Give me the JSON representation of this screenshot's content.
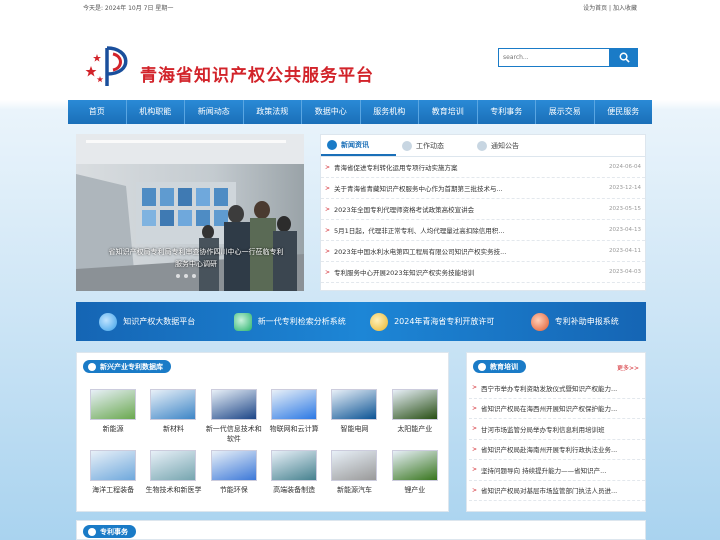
{
  "topbar": {
    "date": "今天是:  2024年 10月 7日 星期一",
    "set_home": "设为首页",
    "sep": "|",
    "favorite": "加入收藏"
  },
  "header": {
    "title": "青海省知识产权公共服务平台"
  },
  "search": {
    "placeholder": "search..."
  },
  "nav": [
    "首页",
    "机构职能",
    "新闻动态",
    "政策法规",
    "数据中心",
    "服务机构",
    "教育培训",
    "专利事务",
    "展示交易",
    "便民服务"
  ],
  "slider": {
    "caption": "省知识产权局专利局专利审查协作四川中心一行莅临专利服务中心调研"
  },
  "news": {
    "tabs": [
      "新闻资讯",
      "工作动态",
      "通知公告"
    ],
    "items": [
      {
        "title": "青海省促进专利转化运用专项行动实施方案",
        "date": "2024-06-04"
      },
      {
        "title": "关于青海省青藏知识产权服务中心作为首期第三批技术与...",
        "date": "2023-12-14"
      },
      {
        "title": "2023年全国专利代理师资格考试政策高校宣讲会",
        "date": "2023-05-15"
      },
      {
        "title": "5月1日起，代理非正常专利、人均代理量过高扣除信用积...",
        "date": "2023-04-13"
      },
      {
        "title": "2023年中国水利水电第四工程局有限公司知识产权实务技...",
        "date": "2023-04-11"
      },
      {
        "title": "专利服务中心开展2023年知识产权实务技能培训",
        "date": "2023-04-03"
      }
    ]
  },
  "banner": [
    {
      "label": "知识产权大数据平台",
      "icon": "globe-icon",
      "color": "#3aa0e8"
    },
    {
      "label": "新一代专利检索分析系统",
      "icon": "search-system-icon",
      "color": "#27b26b"
    },
    {
      "label": "2024年青海省专利开放许可",
      "icon": "license-icon",
      "color": "#e9b52a"
    },
    {
      "label": "专利补助申报系统",
      "icon": "subsidy-icon",
      "color": "#e0572c"
    }
  ],
  "industry": {
    "title": "新兴产业专利数据库",
    "items": [
      {
        "label": "新能源",
        "color": "#6aa84f"
      },
      {
        "label": "新材料",
        "color": "#3d85c6"
      },
      {
        "label": "新一代信息技术和软件",
        "color": "#1c4587"
      },
      {
        "label": "物联网和云计算",
        "color": "#2b78e4"
      },
      {
        "label": "智能电网",
        "color": "#0b5394"
      },
      {
        "label": "太阳能产业",
        "color": "#274e13"
      },
      {
        "label": "海洋工程装备",
        "color": "#6fa8dc"
      },
      {
        "label": "生物技术和新医学",
        "color": "#76a5af"
      },
      {
        "label": "节能环保",
        "color": "#3c78d8"
      },
      {
        "label": "高端装备制造",
        "color": "#45818e"
      },
      {
        "label": "新能源汽车",
        "color": "#999999"
      },
      {
        "label": "锂产业",
        "color": "#38761d"
      }
    ]
  },
  "education": {
    "title": "教育培训",
    "more": "更多>>",
    "items": [
      "西宁市举办专利资助发放仪式暨知识产权能力...",
      "省知识产权局在海西州开展知识产权保护能力...",
      "甘河市场监管分局举办专利信息利用培训班",
      "省知识产权局赴海南州开展专利行政执法业务...",
      "坚持问题导向 持续提升能力——省知识产...",
      "省知识产权局对基层市场监管部门执法人员进..."
    ]
  },
  "patent": {
    "title": "专利事务"
  }
}
